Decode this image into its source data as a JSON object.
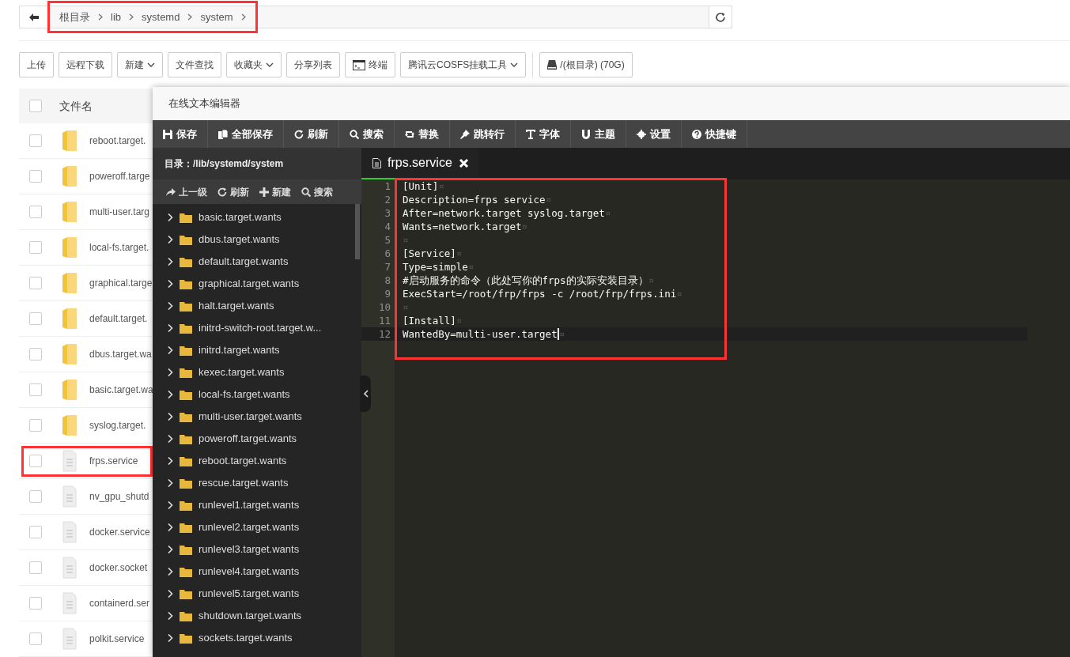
{
  "breadcrumb": {
    "highlighted": true,
    "items": [
      "根目录",
      "lib",
      "systemd",
      "system"
    ]
  },
  "toolbar": [
    {
      "label": "上传",
      "kind": "plain"
    },
    {
      "label": "远程下载",
      "kind": "plain"
    },
    {
      "label": "新建",
      "kind": "dropdown"
    },
    {
      "label": "文件查找",
      "kind": "plain"
    },
    {
      "label": "收藏夹",
      "kind": "dropdown"
    },
    {
      "label": "分享列表",
      "kind": "plain"
    },
    {
      "label": "终端",
      "kind": "terminal"
    },
    {
      "label": "腾讯云COSFS挂载工具",
      "kind": "dropdown"
    },
    {
      "label": "/(根目录) (70G)",
      "kind": "disk"
    }
  ],
  "file_list": {
    "header": "文件名",
    "header_checked": false,
    "rows": [
      {
        "name": "reboot.target.",
        "kind": "folder",
        "checked": false,
        "highlighted": false
      },
      {
        "name": "poweroff.targe",
        "kind": "folder",
        "checked": false,
        "highlighted": false
      },
      {
        "name": "multi-user.targ",
        "kind": "folder",
        "checked": false,
        "highlighted": false
      },
      {
        "name": "local-fs.target.",
        "kind": "folder",
        "checked": false,
        "highlighted": false
      },
      {
        "name": "graphical.targe",
        "kind": "folder",
        "checked": false,
        "highlighted": false
      },
      {
        "name": "default.target.",
        "kind": "folder",
        "checked": false,
        "highlighted": false
      },
      {
        "name": "dbus.target.wa",
        "kind": "folder",
        "checked": false,
        "highlighted": false
      },
      {
        "name": "basic.target.wa",
        "kind": "folder",
        "checked": false,
        "highlighted": false
      },
      {
        "name": "syslog.target.",
        "kind": "folder",
        "checked": false,
        "highlighted": false
      },
      {
        "name": "frps.service",
        "kind": "file",
        "checked": false,
        "highlighted": true
      },
      {
        "name": "nv_gpu_shutd",
        "kind": "file",
        "checked": false,
        "highlighted": false
      },
      {
        "name": "docker.service",
        "kind": "file",
        "checked": false,
        "highlighted": false
      },
      {
        "name": "docker.socket",
        "kind": "file",
        "checked": false,
        "highlighted": false
      },
      {
        "name": "containerd.ser",
        "kind": "file",
        "checked": false,
        "highlighted": false
      },
      {
        "name": "polkit.service",
        "kind": "file",
        "checked": false,
        "highlighted": false
      }
    ]
  },
  "editor": {
    "title": "在线文本编辑器",
    "toolbar": [
      "保存",
      "全部保存",
      "刷新",
      "搜索",
      "替换",
      "跳转行",
      "字体",
      "主题",
      "设置",
      "快捷键"
    ],
    "directory": "目录：/lib/systemd/system",
    "dir_actions": [
      "上一级",
      "刷新",
      "新建",
      "搜索"
    ],
    "tree": [
      {
        "label": "basic.target.wants",
        "expanded": false
      },
      {
        "label": "dbus.target.wants",
        "expanded": false
      },
      {
        "label": "default.target.wants",
        "expanded": false
      },
      {
        "label": "graphical.target.wants",
        "expanded": false
      },
      {
        "label": "halt.target.wants",
        "expanded": false
      },
      {
        "label": "initrd-switch-root.target.w...",
        "expanded": false
      },
      {
        "label": "initrd.target.wants",
        "expanded": false
      },
      {
        "label": "kexec.target.wants",
        "expanded": false
      },
      {
        "label": "local-fs.target.wants",
        "expanded": false
      },
      {
        "label": "multi-user.target.wants",
        "expanded": false
      },
      {
        "label": "poweroff.target.wants",
        "expanded": false
      },
      {
        "label": "reboot.target.wants",
        "expanded": false
      },
      {
        "label": "rescue.target.wants",
        "expanded": false
      },
      {
        "label": "runlevel1.target.wants",
        "expanded": false
      },
      {
        "label": "runlevel2.target.wants",
        "expanded": false
      },
      {
        "label": "runlevel3.target.wants",
        "expanded": false
      },
      {
        "label": "runlevel4.target.wants",
        "expanded": false
      },
      {
        "label": "runlevel5.target.wants",
        "expanded": false
      },
      {
        "label": "shutdown.target.wants",
        "expanded": false
      },
      {
        "label": "sockets.target.wants",
        "expanded": false
      }
    ],
    "tabs": [
      {
        "label": "frps.service",
        "selected": true
      }
    ],
    "code_highlighted": true,
    "eol_mark": "¤",
    "lines": [
      {
        "number": "1",
        "text": "[Unit]",
        "active": false,
        "cursor": false
      },
      {
        "number": "2",
        "text": "Description=frps service",
        "active": false,
        "cursor": false
      },
      {
        "number": "3",
        "text": "After=network.target syslog.target",
        "active": false,
        "cursor": false
      },
      {
        "number": "4",
        "text": "Wants=network.target",
        "active": false,
        "cursor": false
      },
      {
        "number": "5",
        "active": false,
        "cursor": false
      },
      {
        "number": "6",
        "text": "[Service]",
        "active": false,
        "cursor": false
      },
      {
        "number": "7",
        "text": "Type=simple",
        "active": false,
        "cursor": false
      },
      {
        "number": "8",
        "text": "#启动服务的命令（此处写你的frps的实际安装目录）",
        "active": false,
        "cursor": false
      },
      {
        "number": "9",
        "text": "ExecStart=/root/frp/frps -c /root/frp/frps.ini",
        "active": false,
        "cursor": false
      },
      {
        "number": "10",
        "active": false,
        "cursor": false
      },
      {
        "number": "11",
        "text": "[Install]",
        "active": false,
        "cursor": false
      },
      {
        "number": "12",
        "text": "WantedBy=multi-user.target",
        "active": true,
        "cursor": true
      }
    ]
  }
}
